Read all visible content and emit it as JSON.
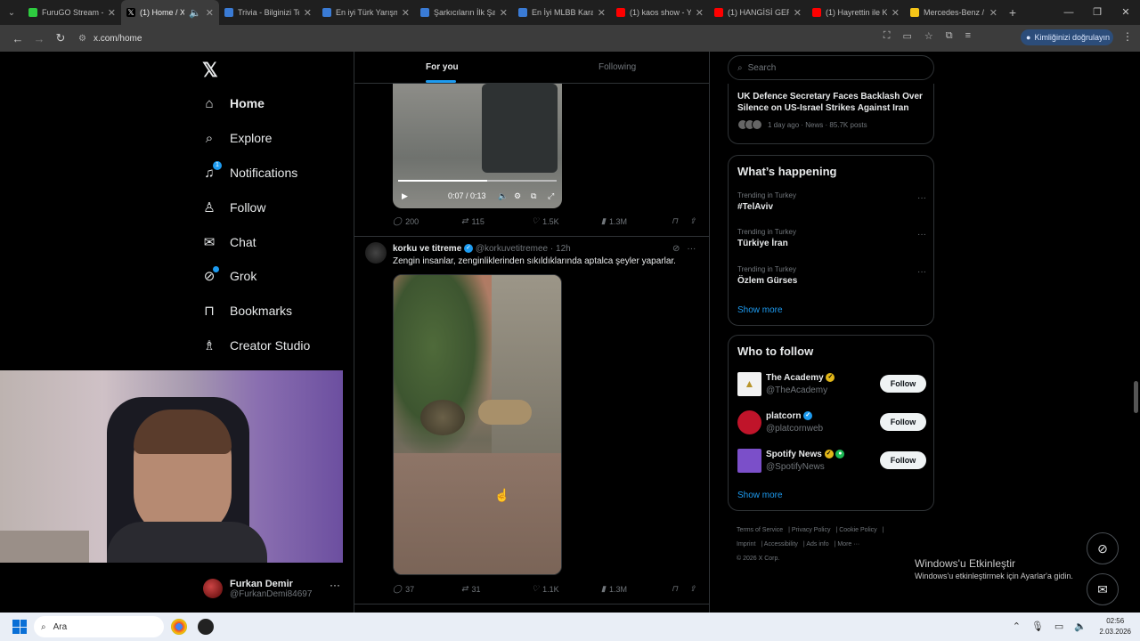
{
  "browser": {
    "tabs": [
      {
        "title": "FuruGO Stream - Y",
        "color": "#2ecc40"
      },
      {
        "title": "(1) Home / X",
        "color": "#ffffff"
      },
      {
        "title": "Trivia - Bilginizi Te",
        "color": "#3a7bd5"
      },
      {
        "title": "En iyi Türk Yarışm",
        "color": "#3a7bd5"
      },
      {
        "title": "Şarkıcıların İlk Şar",
        "color": "#3a7bd5"
      },
      {
        "title": "En İyi MLBB Karak",
        "color": "#3a7bd5"
      },
      {
        "title": "(1) kaos show - Yo",
        "color": "#ff0000"
      },
      {
        "title": "(1) HANGİSİ GERÇ",
        "color": "#ff0000"
      },
      {
        "title": "(1) Hayrettin ile K",
        "color": "#ff0000"
      },
      {
        "title": "Mercedes-Benz /",
        "color": "#f5c518"
      }
    ],
    "url": "x.com/home",
    "verify_label": "Kimliğinizi doğrulayın"
  },
  "nav": {
    "items": [
      {
        "label": "Home",
        "icon": "home-icon"
      },
      {
        "label": "Explore",
        "icon": "search-icon"
      },
      {
        "label": "Notifications",
        "icon": "bell-icon"
      },
      {
        "label": "Follow",
        "icon": "person-plus-icon"
      },
      {
        "label": "Chat",
        "icon": "envelope-icon"
      },
      {
        "label": "Grok",
        "icon": "grok-icon"
      },
      {
        "label": "Bookmarks",
        "icon": "bookmark-icon"
      },
      {
        "label": "Creator Studio",
        "icon": "creator-studio-icon"
      }
    ],
    "notif_count": "1",
    "account": {
      "name": "Furkan Demir",
      "handle": "@FurkanDemi84697"
    }
  },
  "feed": {
    "tabs": {
      "for_you": "For you",
      "following": "Following"
    },
    "tweet1": {
      "video_time": "0:07 / 0:13",
      "replies": "200",
      "reposts": "115",
      "likes": "1.5K",
      "views": "1.3M"
    },
    "tweet2": {
      "name": "korku ve titreme",
      "handle": "@korkuvetitremee",
      "time": "· 12h",
      "text": "Zengin insanlar, zenginliklerinden sıkıldıklarında aptalca şeyler yaparlar.",
      "replies": "37",
      "reposts": "31",
      "likes": "1.1K",
      "views": "1.3M"
    }
  },
  "sidebar": {
    "search_placeholder": "Search",
    "news": {
      "title": "UK Defence Secretary Faces Backlash Over Silence on US-Israel Strikes Against Iran",
      "meta": "1 day ago · News · 85.7K posts"
    },
    "happening": {
      "title": "What’s happening",
      "trends": [
        {
          "context": "Trending in Turkey",
          "name": "#TelAviv"
        },
        {
          "context": "Trending in Turkey",
          "name": "Türkiye İran"
        },
        {
          "context": "Trending in Turkey",
          "name": "Özlem Gürses"
        }
      ],
      "show_more": "Show more"
    },
    "who_to_follow": {
      "title": "Who to follow",
      "accounts": [
        {
          "name": "The Academy",
          "handle": "@TheAcademy",
          "badge": "gold",
          "color": "#f2f2f2"
        },
        {
          "name": "platcorn",
          "handle": "@platcornweb",
          "badge": "blue",
          "color": "#c0142a"
        },
        {
          "name": "Spotify News",
          "handle": "@SpotifyNews",
          "badge": "gold",
          "color": "#7b4fc9"
        }
      ],
      "follow_label": "Follow",
      "show_more": "Show more"
    },
    "footer": {
      "links": [
        "Terms of Service",
        "Privacy Policy",
        "Cookie Policy",
        "Imprint",
        "Accessibility",
        "Ads info",
        "More ···"
      ],
      "copyright": "© 2026 X Corp."
    }
  },
  "overlay": {
    "activate_title": "Windows'u Etkinleştir",
    "activate_sub": "Windows'u etkinleştirmek için Ayarlar'a gidin."
  },
  "taskbar": {
    "search": "Ara",
    "time": "02:56",
    "date": "2.03.2026"
  }
}
